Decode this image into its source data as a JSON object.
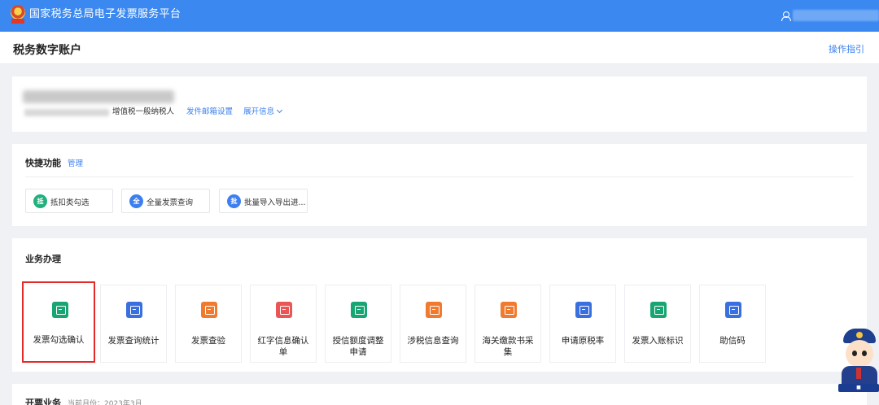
{
  "topbar": {
    "site_title": "国家税务总局电子发票服务平台"
  },
  "page": {
    "title": "税务数字账户",
    "guide_link": "操作指引"
  },
  "account": {
    "taxpayer_type": "增值税一般纳税人",
    "mail_setting_link": "发件邮箱设置",
    "expand_link": "展开信息"
  },
  "quick": {
    "title": "快捷功能",
    "manage_link": "管理",
    "items": [
      {
        "badge": "抵",
        "label": "抵扣类勾选",
        "color": "#22b07d"
      },
      {
        "badge": "全",
        "label": "全量发票查询",
        "color": "#3d7ff0"
      },
      {
        "badge": "批",
        "label": "批量导入导出进...",
        "color": "#3d7ff0"
      }
    ]
  },
  "business": {
    "title": "业务办理",
    "tiles": [
      {
        "label": "发票勾选确认",
        "color": "#17a673",
        "selected": true
      },
      {
        "label": "发票查询统计",
        "color": "#3a6fe0"
      },
      {
        "label": "发票查验",
        "color": "#f07a2e"
      },
      {
        "label": "红字信息确认单",
        "color": "#ea5656"
      },
      {
        "label": "授信额度调整申请",
        "color": "#17a673"
      },
      {
        "label": "涉税信息查询",
        "color": "#f07a2e"
      },
      {
        "label": "海关缴款书采集",
        "color": "#f07a2e"
      },
      {
        "label": "申请原税率",
        "color": "#3a6fe0"
      },
      {
        "label": "发票入账标识",
        "color": "#17a673"
      },
      {
        "label": "助信码",
        "color": "#3a6fe0"
      }
    ]
  },
  "invoicing": {
    "title": "开票业务",
    "current_month": "当前月份：2023年3月"
  },
  "colors": {
    "topbar": "#3a88f0",
    "link": "#3a7ff0",
    "selected_border": "#e22a2a"
  }
}
